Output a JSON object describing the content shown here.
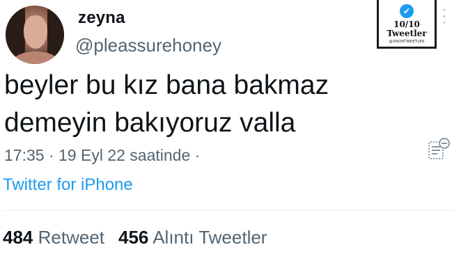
{
  "author": {
    "display_name": "zeyna",
    "handle": "@pleassurehoney"
  },
  "tweet": {
    "line1": "beyler bu kız bana bakmaz",
    "line2": "demeyin bakıyoruz valla",
    "time": "17:35",
    "date": "19 Eyl 22 saatinde",
    "separator": "·",
    "source": "Twitter for iPhone"
  },
  "stats": {
    "retweet_count": "484",
    "retweet_label": "Retweet",
    "quote_count": "456",
    "quote_label": "Alıntı Tweetler"
  },
  "stamp": {
    "score": "10/10",
    "label": "Tweetler",
    "small": "@ONONTWEETLER"
  },
  "icons": {
    "more": "more-vertical-icon",
    "note": "note-icon",
    "bird": "twitter-bird-icon"
  },
  "colors": {
    "accent": "#1d9bf0",
    "muted": "#536471",
    "text": "#0f1419"
  }
}
